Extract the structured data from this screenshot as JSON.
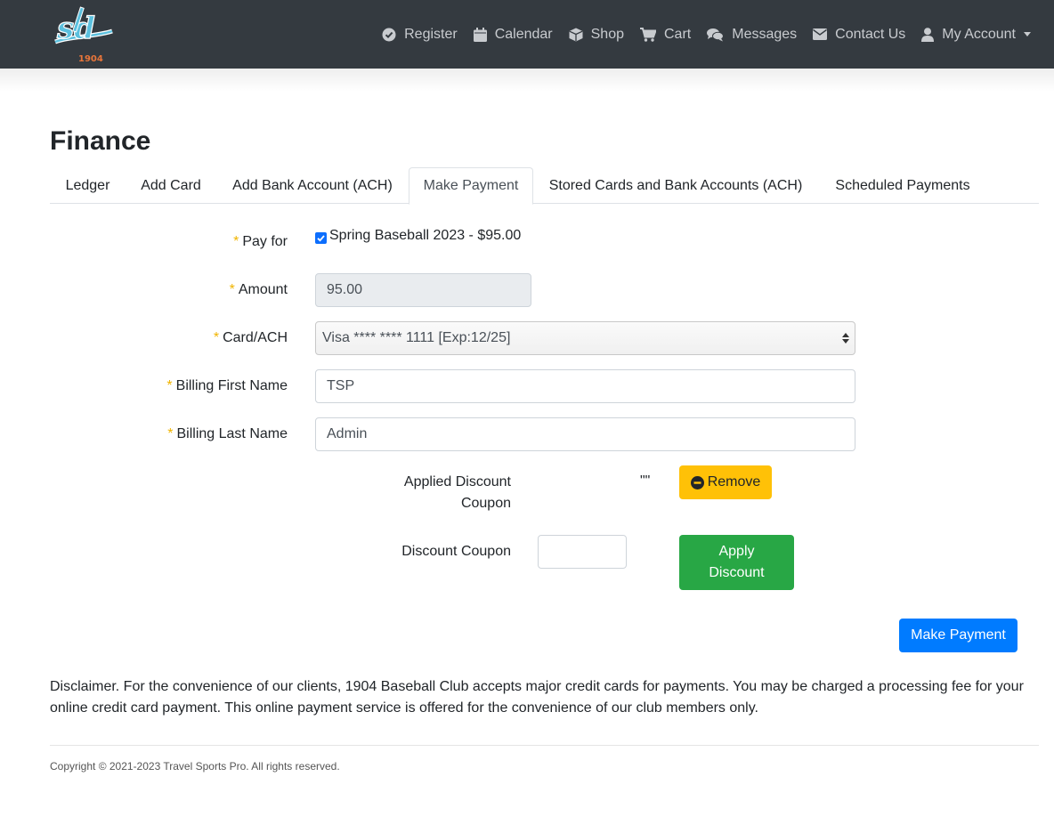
{
  "navbar": {
    "logo": {
      "monogram": "sd",
      "year": "1904"
    },
    "items": [
      {
        "label": "Register",
        "icon": "check-circle-icon"
      },
      {
        "label": "Calendar",
        "icon": "calendar-icon"
      },
      {
        "label": "Shop",
        "icon": "cube-icon"
      },
      {
        "label": "Cart",
        "icon": "cart-icon"
      },
      {
        "label": "Messages",
        "icon": "comments-icon"
      },
      {
        "label": "Contact Us",
        "icon": "envelope-icon"
      },
      {
        "label": "My Account",
        "icon": "user-icon"
      }
    ]
  },
  "page": {
    "title": "Finance"
  },
  "tabs": [
    {
      "label": "Ledger"
    },
    {
      "label": "Add Card"
    },
    {
      "label": "Add Bank Account (ACH)"
    },
    {
      "label": "Make Payment",
      "active": true
    },
    {
      "label": "Stored Cards and Bank Accounts (ACH)"
    },
    {
      "label": "Scheduled Payments"
    }
  ],
  "form": {
    "required_mark": "*",
    "pay_for": {
      "label": "Pay for",
      "option": "Spring Baseball 2023 - $95.00",
      "checked": true
    },
    "amount": {
      "label": "Amount",
      "value": "95.00"
    },
    "card": {
      "label": "Card/ACH",
      "value": "Visa **** **** 1111 [Exp:12/25]"
    },
    "first_name": {
      "label": "Billing First Name",
      "value": "TSP"
    },
    "last_name": {
      "label": "Billing Last Name",
      "value": "Admin"
    },
    "applied_discount": {
      "label_line1": "Applied Discount",
      "label_line2": "Coupon",
      "value": "\"\"",
      "remove_label": "Remove"
    },
    "discount_coupon": {
      "label": "Discount Coupon",
      "value": "",
      "apply_line1": "Apply",
      "apply_line2": "Discount"
    },
    "submit_label": "Make Payment"
  },
  "disclaimer": "Disclaimer. For the convenience of our clients, 1904 Baseball Club accepts major credit cards for payments. You may be charged a processing fee for your online credit card payment. This online payment service is offered for the convenience of our club members only.",
  "footer": {
    "copyright": "Copyright © 2021-2023 Travel Sports Pro. All rights reserved."
  },
  "colors": {
    "navbar_bg": "#343a40",
    "required": "#f0b400",
    "warning": "#ffc107",
    "success": "#28a745",
    "primary": "#007bff"
  }
}
